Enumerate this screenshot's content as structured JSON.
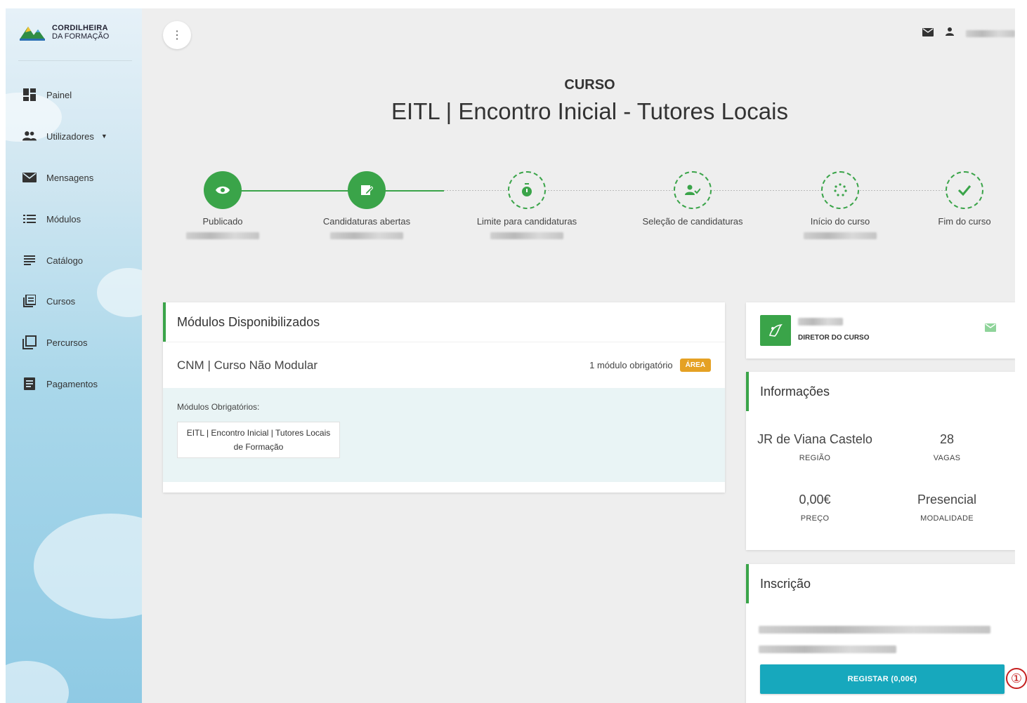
{
  "brand": {
    "line1": "CORDILHEIRA",
    "line2": "DA FORMAÇÃO"
  },
  "sidebar": {
    "items": [
      {
        "label": "Painel",
        "icon": "dashboard-icon"
      },
      {
        "label": "Utilizadores",
        "icon": "users-icon"
      },
      {
        "label": "Mensagens",
        "icon": "mail-icon"
      },
      {
        "label": "Módulos",
        "icon": "list-icon"
      },
      {
        "label": "Catálogo",
        "icon": "catalog-icon"
      },
      {
        "label": "Cursos",
        "icon": "courses-icon"
      },
      {
        "label": "Percursos",
        "icon": "paths-icon"
      },
      {
        "label": "Pagamentos",
        "icon": "payments-icon"
      }
    ]
  },
  "course": {
    "kicker": "CURSO",
    "title": "EITL | Encontro Inicial - Tutores Locais"
  },
  "steps": [
    {
      "label": "Publicado",
      "status": "done",
      "icon": "eye-icon"
    },
    {
      "label": "Candidaturas abertas",
      "status": "done",
      "icon": "edit-icon"
    },
    {
      "label": "Limite para candidaturas",
      "status": "todo",
      "icon": "timer-icon"
    },
    {
      "label": "Seleção de candidaturas",
      "status": "todo",
      "icon": "user-check-icon"
    },
    {
      "label": "Início do curso",
      "status": "todo",
      "icon": "loading-icon"
    },
    {
      "label": "Fim do curso",
      "status": "todo",
      "icon": "check-icon"
    }
  ],
  "modules": {
    "header": "Módulos Disponibilizados",
    "group_title": "CNM | Curso Não Modular",
    "group_meta": "1 módulo obrigatório",
    "badge": "ÁREA",
    "mandatory_label": "Módulos Obrigatórios:",
    "module_name": "EITL | Encontro Inicial | Tutores Locais de Formação"
  },
  "director": {
    "role": "DIRETOR DO CURSO"
  },
  "info": {
    "header": "Informações",
    "region_value": "JR de Viana Castelo",
    "region_key": "REGIÃO",
    "slots_value": "28",
    "slots_key": "VAGAS",
    "price_value": "0,00€",
    "price_key": "PREÇO",
    "mode_value": "Presencial",
    "mode_key": "MODALIDADE"
  },
  "signup": {
    "header": "Inscrição",
    "button_label": "REGISTAR (0,00€)"
  },
  "annotation": {
    "marker": "①"
  },
  "colors": {
    "accent": "#3aa449",
    "button": "#17a8bd",
    "badge": "#e5a124"
  }
}
